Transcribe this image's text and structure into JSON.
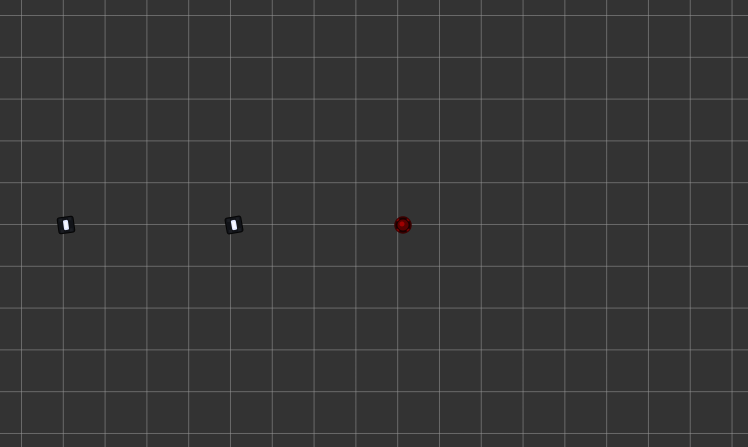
{
  "scene": {
    "background_color": "#333333",
    "grid_color": "#969696",
    "entities": [
      {
        "kind": "player-unit",
        "icon": "unit-icon",
        "color": "#dfe6ff"
      },
      {
        "kind": "player-unit",
        "icon": "unit-icon",
        "color": "#dfe6ff"
      },
      {
        "kind": "enemy-target",
        "icon": "red-enemy-icon",
        "color": "#8b0000"
      }
    ]
  }
}
